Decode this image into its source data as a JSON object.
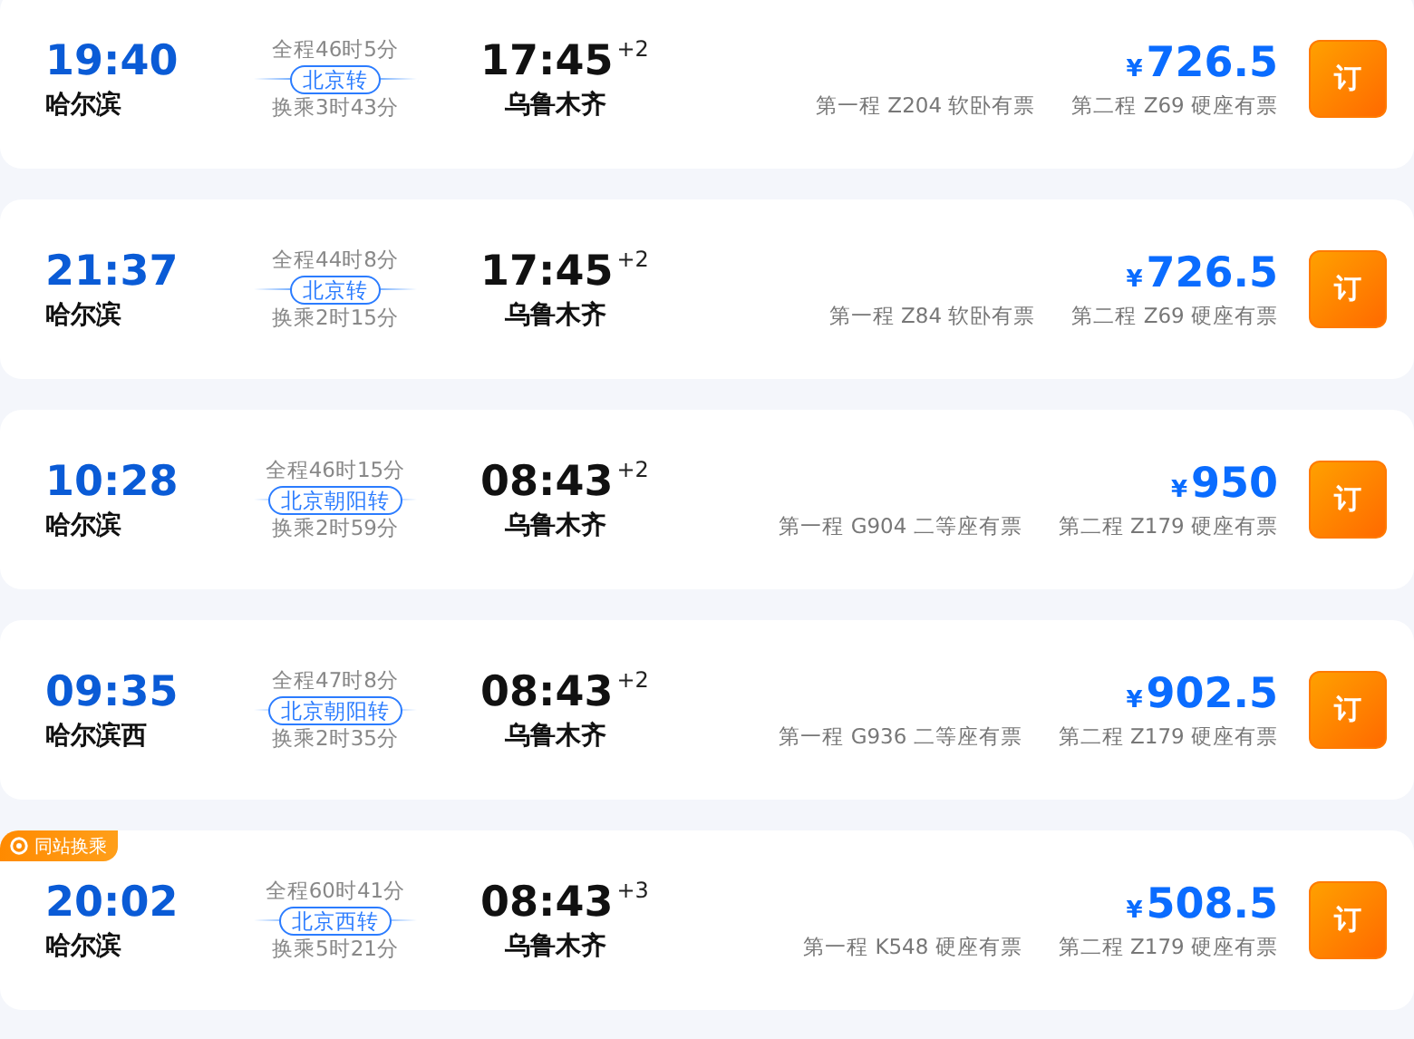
{
  "trips": [
    {
      "depart_time": "19:40",
      "depart_station": "哈尔滨",
      "duration": "全程46时5分",
      "transfer": "北京转",
      "wait": "换乘3时43分",
      "arrive_time": "17:45",
      "day_offset": "+2",
      "arrive_station": "乌鲁木齐",
      "currency": "¥",
      "price": "726.5",
      "leg1": "第一程 Z204 软卧有票",
      "leg2": "第二程 Z69 硬座有票",
      "book": "订"
    },
    {
      "depart_time": "21:37",
      "depart_station": "哈尔滨",
      "duration": "全程44时8分",
      "transfer": "北京转",
      "wait": "换乘2时15分",
      "arrive_time": "17:45",
      "day_offset": "+2",
      "arrive_station": "乌鲁木齐",
      "currency": "¥",
      "price": "726.5",
      "leg1": "第一程 Z84 软卧有票",
      "leg2": "第二程 Z69 硬座有票",
      "book": "订"
    },
    {
      "depart_time": "10:28",
      "depart_station": "哈尔滨",
      "duration": "全程46时15分",
      "transfer": "北京朝阳转",
      "wait": "换乘2时59分",
      "arrive_time": "08:43",
      "day_offset": "+2",
      "arrive_station": "乌鲁木齐",
      "currency": "¥",
      "price": "950",
      "leg1": "第一程 G904 二等座有票",
      "leg2": "第二程 Z179 硬座有票",
      "book": "订"
    },
    {
      "depart_time": "09:35",
      "depart_station": "哈尔滨西",
      "duration": "全程47时8分",
      "transfer": "北京朝阳转",
      "wait": "换乘2时35分",
      "arrive_time": "08:43",
      "day_offset": "+2",
      "arrive_station": "乌鲁木齐",
      "currency": "¥",
      "price": "902.5",
      "leg1": "第一程 G936 二等座有票",
      "leg2": "第二程 Z179 硬座有票",
      "book": "订"
    },
    {
      "badge": "同站换乘",
      "depart_time": "20:02",
      "depart_station": "哈尔滨",
      "duration": "全程60时41分",
      "transfer": "北京西转",
      "wait": "换乘5时21分",
      "arrive_time": "08:43",
      "day_offset": "+3",
      "arrive_station": "乌鲁木齐",
      "currency": "¥",
      "price": "508.5",
      "leg1": "第一程 K548 硬座有票",
      "leg2": "第二程 Z179 硬座有票",
      "book": "订"
    }
  ]
}
